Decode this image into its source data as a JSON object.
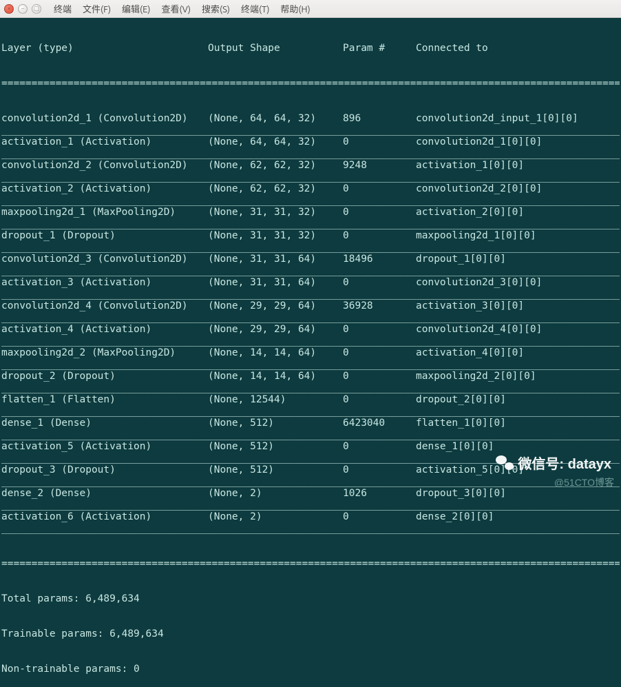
{
  "window": {
    "menu": [
      "终端",
      "文件(F)",
      "编辑(E)",
      "查看(V)",
      "搜索(S)",
      "终端(T)",
      "帮助(H)"
    ]
  },
  "header": {
    "layer": "Layer (type)",
    "shape": "Output Shape",
    "param": "Param #",
    "conn": "Connected to"
  },
  "rows": [
    {
      "layer": "convolution2d_1 (Convolution2D)",
      "shape": "(None, 64, 64, 32)",
      "param": "896",
      "conn": "convolution2d_input_1[0][0]"
    },
    {
      "layer": "activation_1 (Activation)",
      "shape": "(None, 64, 64, 32)",
      "param": "0",
      "conn": "convolution2d_1[0][0]"
    },
    {
      "layer": "convolution2d_2 (Convolution2D)",
      "shape": "(None, 62, 62, 32)",
      "param": "9248",
      "conn": "activation_1[0][0]"
    },
    {
      "layer": "activation_2 (Activation)",
      "shape": "(None, 62, 62, 32)",
      "param": "0",
      "conn": "convolution2d_2[0][0]"
    },
    {
      "layer": "maxpooling2d_1 (MaxPooling2D)",
      "shape": "(None, 31, 31, 32)",
      "param": "0",
      "conn": "activation_2[0][0]"
    },
    {
      "layer": "dropout_1 (Dropout)",
      "shape": "(None, 31, 31, 32)",
      "param": "0",
      "conn": "maxpooling2d_1[0][0]"
    },
    {
      "layer": "convolution2d_3 (Convolution2D)",
      "shape": "(None, 31, 31, 64)",
      "param": "18496",
      "conn": "dropout_1[0][0]"
    },
    {
      "layer": "activation_3 (Activation)",
      "shape": "(None, 31, 31, 64)",
      "param": "0",
      "conn": "convolution2d_3[0][0]"
    },
    {
      "layer": "convolution2d_4 (Convolution2D)",
      "shape": "(None, 29, 29, 64)",
      "param": "36928",
      "conn": "activation_3[0][0]"
    },
    {
      "layer": "activation_4 (Activation)",
      "shape": "(None, 29, 29, 64)",
      "param": "0",
      "conn": "convolution2d_4[0][0]"
    },
    {
      "layer": "maxpooling2d_2 (MaxPooling2D)",
      "shape": "(None, 14, 14, 64)",
      "param": "0",
      "conn": "activation_4[0][0]"
    },
    {
      "layer": "dropout_2 (Dropout)",
      "shape": "(None, 14, 14, 64)",
      "param": "0",
      "conn": "maxpooling2d_2[0][0]"
    },
    {
      "layer": "flatten_1 (Flatten)",
      "shape": "(None, 12544)",
      "param": "0",
      "conn": "dropout_2[0][0]"
    },
    {
      "layer": "dense_1 (Dense)",
      "shape": "(None, 512)",
      "param": "6423040",
      "conn": "flatten_1[0][0]"
    },
    {
      "layer": "activation_5 (Activation)",
      "shape": "(None, 512)",
      "param": "0",
      "conn": "dense_1[0][0]"
    },
    {
      "layer": "dropout_3 (Dropout)",
      "shape": "(None, 512)",
      "param": "0",
      "conn": "activation_5[0][0]"
    },
    {
      "layer": "dense_2 (Dense)",
      "shape": "(None, 2)",
      "param": "1026",
      "conn": "dropout_3[0][0]"
    },
    {
      "layer": "activation_6 (Activation)",
      "shape": "(None, 2)",
      "param": "0",
      "conn": "dense_2[0][0]"
    }
  ],
  "summary": {
    "total": "Total params: 6,489,634",
    "trainable": "Trainable params: 6,489,634",
    "nontrainable": "Non-trainable params: 0"
  },
  "watermark": {
    "a": "微信号: datayx",
    "b": "@51CTO博客"
  }
}
